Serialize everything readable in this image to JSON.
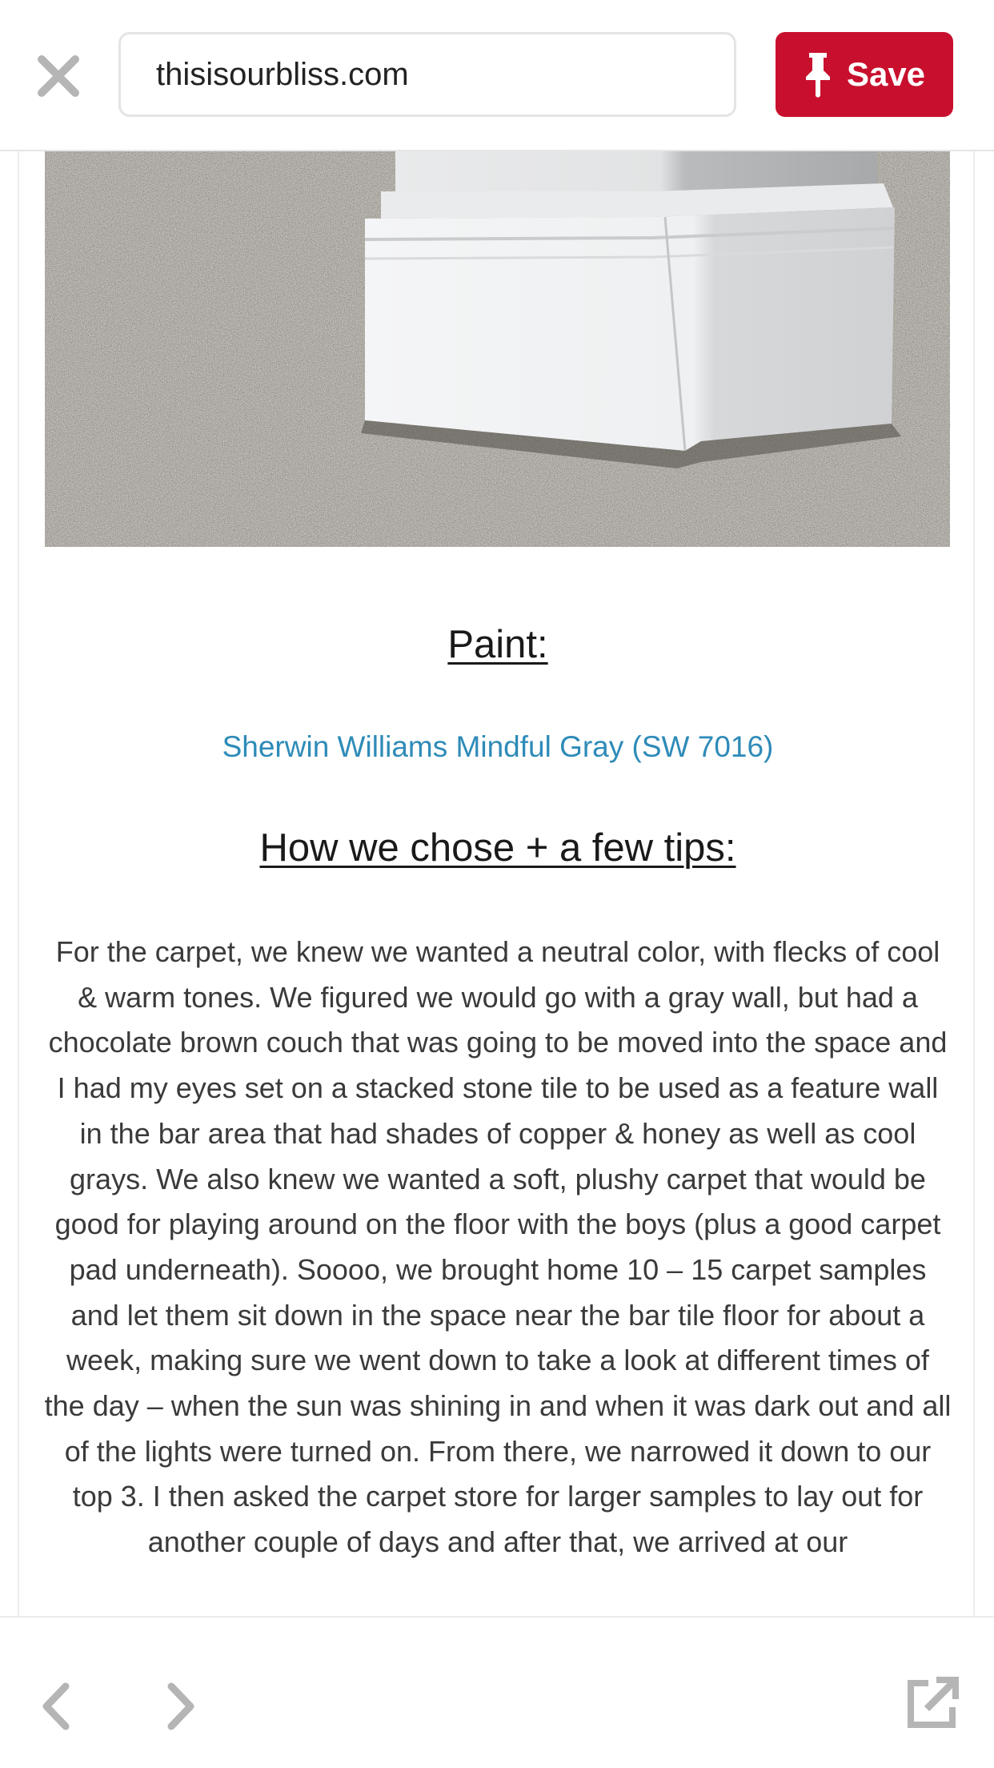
{
  "header": {
    "url": "thisisourbliss.com",
    "save_label": "Save",
    "close_icon": "close-icon",
    "pin_icon": "pin-icon"
  },
  "article": {
    "photo": "carpet-and-baseboard-photo",
    "paint_heading": "Paint:",
    "paint_link": "Sherwin Williams Mindful Gray (SW 7016)",
    "tips_heading": "How we chose + a few tips:",
    "body": "For the carpet, we knew we wanted a neutral color, with flecks of cool & warm tones. We figured we would go with a gray wall, but had a chocolate brown couch that was going to be moved into the space and I had my eyes set on a stacked stone tile to be used as a feature wall in the bar area that had shades of copper & honey as well as cool grays. We also knew we wanted a soft, plushy carpet that would be good for playing around on the floor with the boys (plus a good carpet pad underneath). Soooo, we brought home 10 – 15 carpet samples and let them sit down in the space near the bar tile floor for about a week, making sure we went down to take a look at different times of the day – when the sun was shining in and when it was dark out and all of the lights were turned on. From there, we narrowed it down to our top 3. I then asked the carpet store for larger samples to lay out for another couple of days and after that, we arrived at our"
  },
  "footer": {
    "back_icon": "chevron-left-icon",
    "forward_icon": "chevron-right-icon",
    "share_icon": "external-link-icon"
  },
  "colors": {
    "save_red": "#c8102e",
    "link_blue": "#2e8bb8",
    "icon_gray": "#b5b5b5"
  }
}
